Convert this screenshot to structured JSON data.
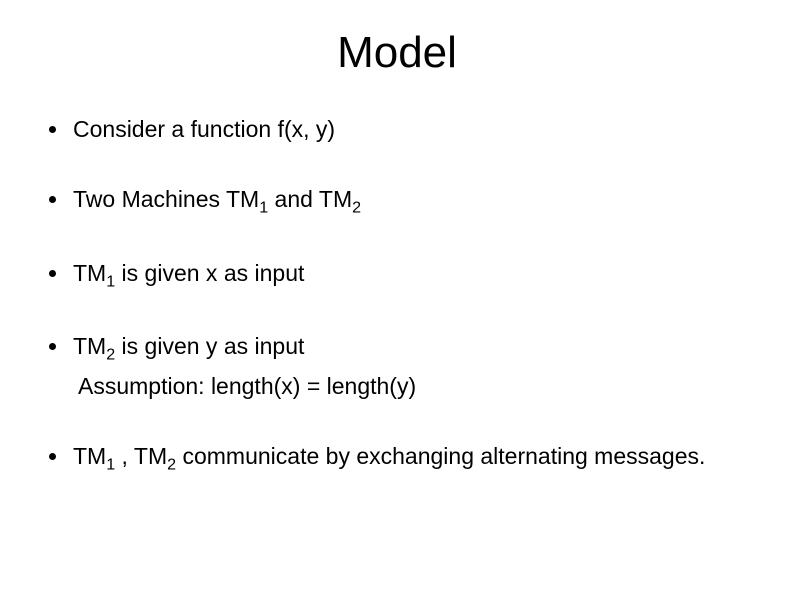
{
  "title": "Model",
  "bullets": {
    "b1": {
      "text": "Consider a function f(x, y)"
    },
    "b2": {
      "prefix": "Two Machines TM",
      "s1": "1",
      "mid": " and TM",
      "s2": "2"
    },
    "b3": {
      "prefix": "TM",
      "s1": "1",
      "suffix": " is given x as input"
    },
    "b4": {
      "prefix": "TM",
      "s1": "2",
      "suffix": " is given y as input"
    },
    "b4sub": "Assumption: length(x) = length(y)",
    "b5": {
      "prefix": "TM",
      "s1": "1",
      "mid": " , TM",
      "s2": "2",
      "suffix": " communicate by exchanging alternating messages."
    }
  }
}
